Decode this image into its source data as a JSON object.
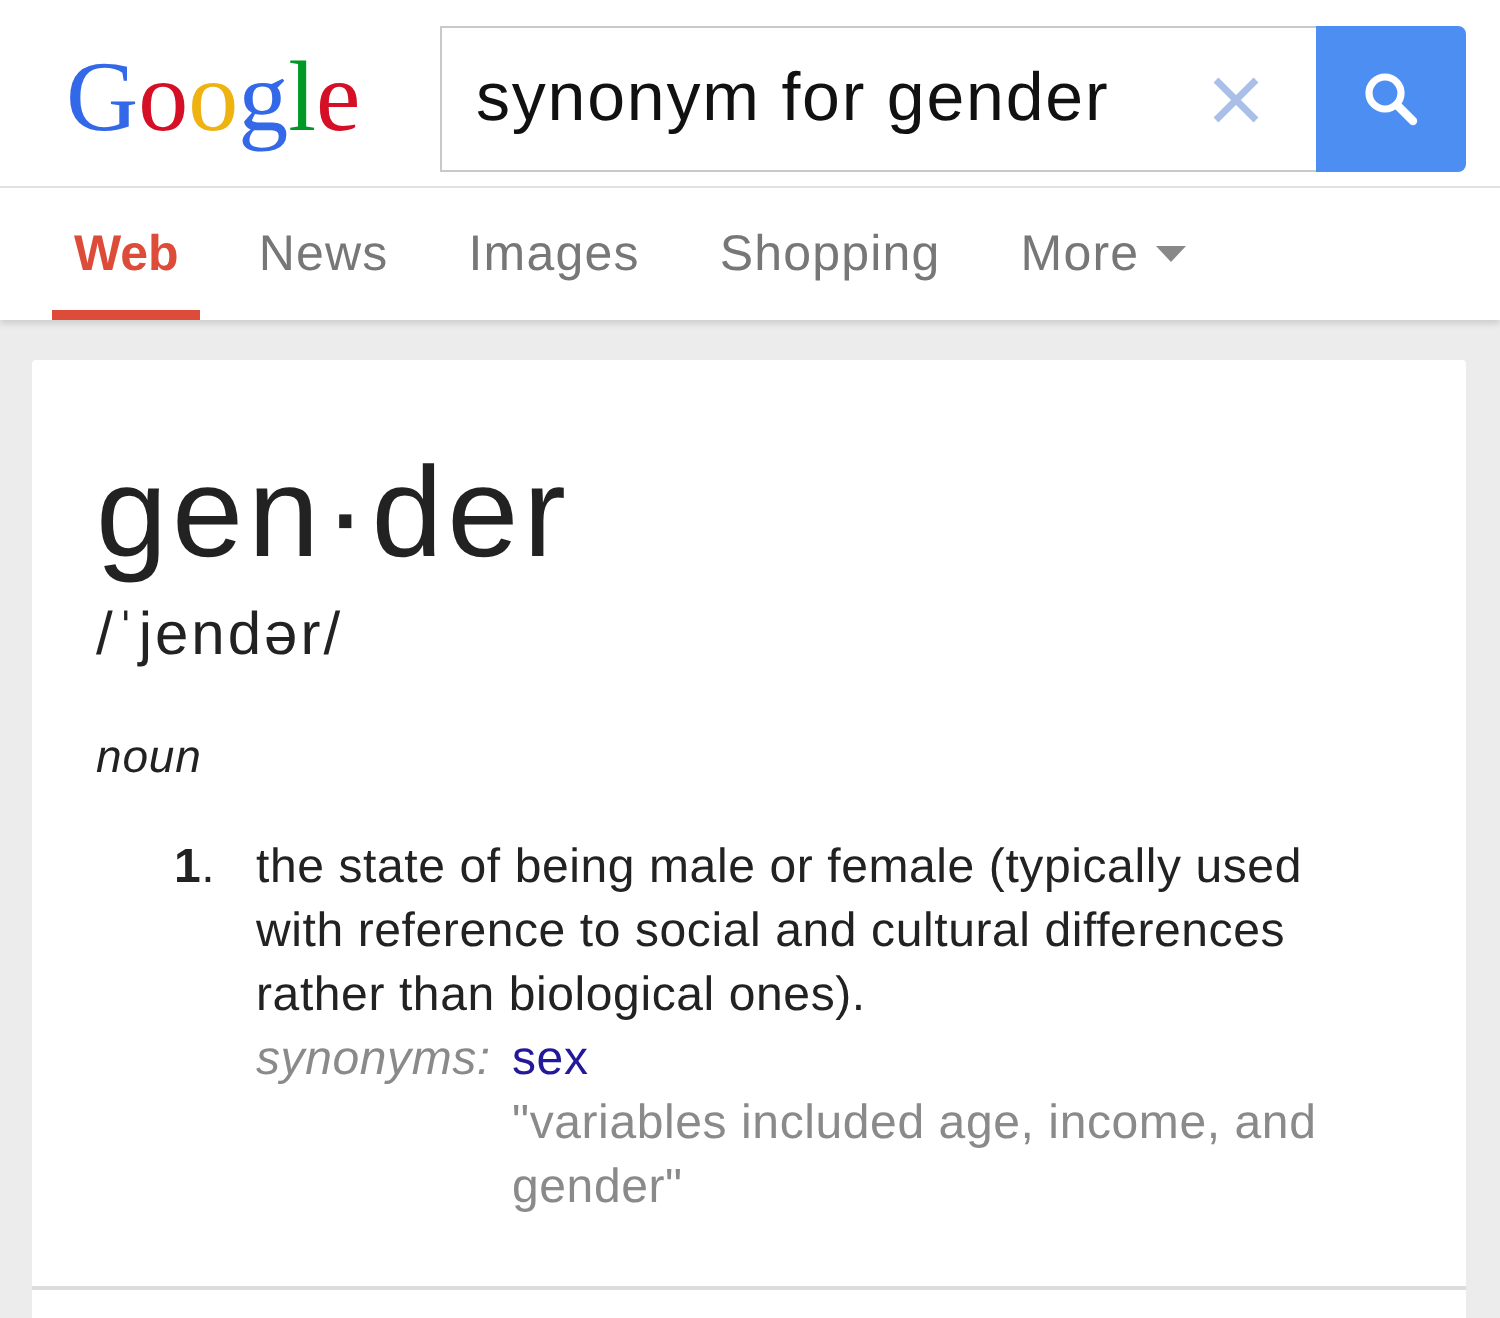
{
  "header": {
    "logo": "Google",
    "search": {
      "value": "synonym for gender"
    }
  },
  "tabs": [
    {
      "label": "Web",
      "selected": true,
      "kind": "link"
    },
    {
      "label": "News",
      "selected": false,
      "kind": "link"
    },
    {
      "label": "Images",
      "selected": false,
      "kind": "link"
    },
    {
      "label": "Shopping",
      "selected": false,
      "kind": "link"
    },
    {
      "label": "More",
      "selected": false,
      "kind": "dropdown"
    }
  ],
  "definition_card": {
    "headword": "gen·der",
    "pronunciation": "/ˈjendər/",
    "part_of_speech": "noun",
    "senses": [
      {
        "number": "**1**.",
        "text": "the state of being male or female (typically used with reference to social and cultural differences rather than biological ones).",
        "synonyms_label": "synonyms:",
        "synonyms": [
          "sex"
        ],
        "example": "\"variables included age, income, and gender\""
      }
    ]
  }
}
